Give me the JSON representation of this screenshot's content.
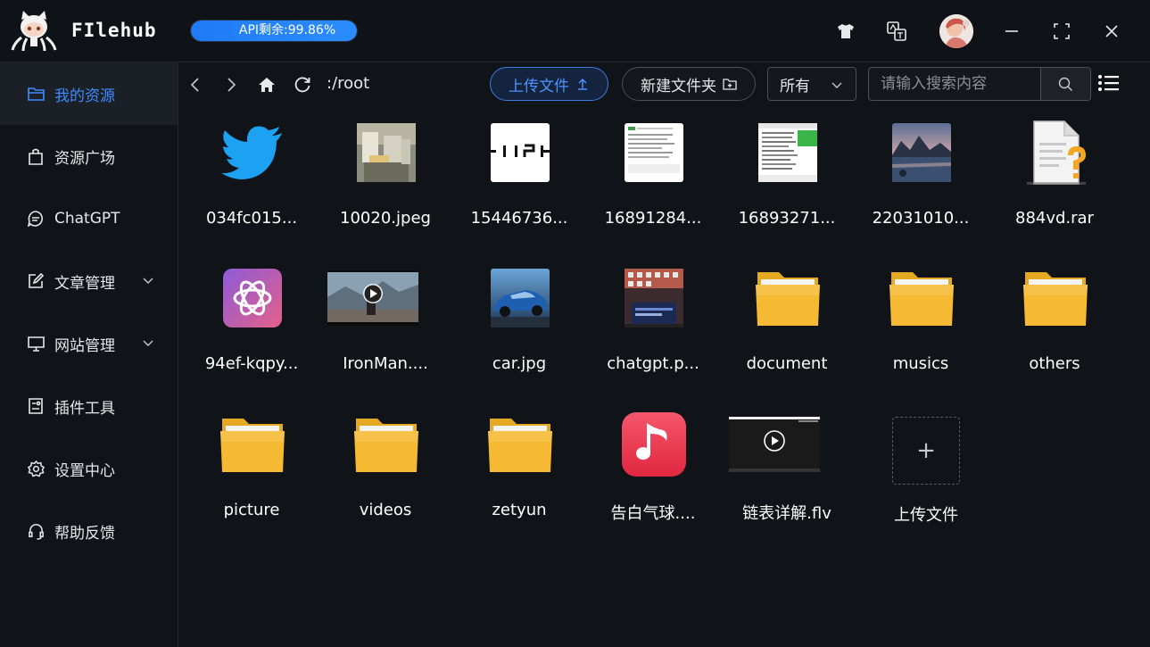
{
  "app": {
    "name": "FIlehub",
    "api_label": "API剩余:99.86%",
    "api_remaining_percent": 99.86,
    "accent_color": "#2b8cff"
  },
  "titlebar": {
    "icons": [
      "theme-shirt-icon",
      "translate-icon",
      "avatar",
      "minimize-icon",
      "maximize-icon",
      "close-icon"
    ]
  },
  "sidebar": {
    "items": [
      {
        "label": "我的资源",
        "icon": "folder-icon",
        "active": true
      },
      {
        "label": "资源广场",
        "icon": "shopping-bag-icon"
      },
      {
        "label": "ChatGPT",
        "icon": "chat-bubble-icon"
      },
      {
        "label": "文章管理",
        "icon": "edit-icon",
        "expandable": true
      },
      {
        "label": "网站管理",
        "icon": "monitor-icon",
        "expandable": true
      },
      {
        "label": "插件工具",
        "icon": "plugin-icon"
      },
      {
        "label": "设置中心",
        "icon": "gear-icon"
      },
      {
        "label": "帮助反馈",
        "icon": "headset-icon"
      }
    ]
  },
  "toolbar": {
    "path": ":/root",
    "upload_label": "上传文件",
    "new_folder_label": "新建文件夹",
    "filter_value": "所有",
    "search_placeholder": "请输入搜索内容"
  },
  "files": [
    {
      "name": "034fc015...",
      "kind": "twitter-image"
    },
    {
      "name": "10020.jpeg",
      "kind": "photo-room"
    },
    {
      "name": "15446736...",
      "kind": "logo-hiphi"
    },
    {
      "name": "16891284...",
      "kind": "screenshot-doc"
    },
    {
      "name": "16893271...",
      "kind": "screenshot-doc-green"
    },
    {
      "name": "22031010...",
      "kind": "photo-landscape"
    },
    {
      "name": "884vd.rar",
      "kind": "unknown-file"
    },
    {
      "name": "94ef-kqpy...",
      "kind": "openai-logo"
    },
    {
      "name": "IronMan....",
      "kind": "video-thumb"
    },
    {
      "name": "car.jpg",
      "kind": "photo-car"
    },
    {
      "name": "chatgpt.p...",
      "kind": "screenshot-desktop"
    },
    {
      "name": "document",
      "kind": "folder"
    },
    {
      "name": "musics",
      "kind": "folder"
    },
    {
      "name": "others",
      "kind": "folder"
    },
    {
      "name": "picture",
      "kind": "folder"
    },
    {
      "name": "videos",
      "kind": "folder"
    },
    {
      "name": "zetyun",
      "kind": "folder"
    },
    {
      "name": "告白气球....",
      "kind": "music"
    },
    {
      "name": "链表详解.flv",
      "kind": "video-dark"
    }
  ],
  "upload_tile": {
    "label": "上传文件"
  }
}
